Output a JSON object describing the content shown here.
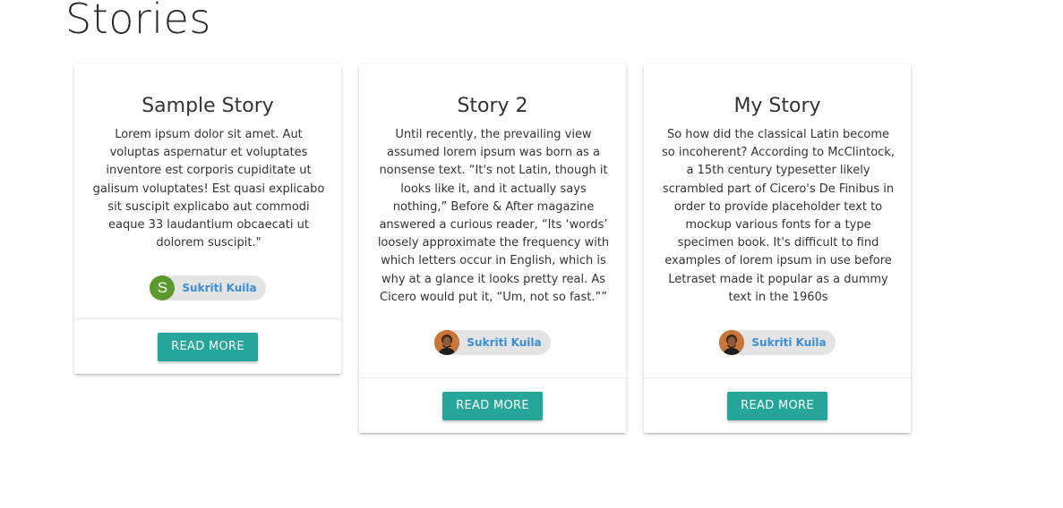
{
  "page": {
    "title": "Stories"
  },
  "colors": {
    "accent": "#26a69a",
    "author_link": "#3a8dd8",
    "avatar_initial_bg": "#5c9a2e",
    "chip_bg": "#e4e4e4"
  },
  "stories": [
    {
      "title": "Sample Story",
      "text": "Lorem ipsum dolor sit amet. Aut voluptas aspernatur et voluptates inventore est corporis cupiditate ut galisum voluptates! Est quasi explicabo sit suscipit explicabo aut commodi eaque 33 laudantium obcaecati ut dolorem suscipit.\"",
      "author": {
        "name": "Sukriti Kuila",
        "avatar_initial": "S",
        "avatar_icon": "letter-avatar"
      },
      "button_label": "READ MORE"
    },
    {
      "title": "Story 2",
      "text": "Until recently, the prevailing view assumed lorem ipsum was born as a nonsense text. “It's not Latin, though it looks like it, and it actually says nothing,” Before & After magazine answered a curious reader, “Its ‘words’ loosely approximate the frequency with which letters occur in English, which is why at a glance it looks pretty real. As Cicero would put it, “Um, not so fast.””",
      "author": {
        "name": "Sukriti Kuila",
        "avatar_icon": "user-photo-avatar"
      },
      "button_label": "READ MORE"
    },
    {
      "title": "My Story",
      "text": "So how did the classical Latin become so incoherent? According to McClintock, a 15th century typesetter likely scrambled part of Cicero's De Finibus in order to provide placeholder text to mockup various fonts for a type specimen book. It's difficult to find examples of lorem ipsum in use before Letraset made it popular as a dummy text in the 1960s",
      "author": {
        "name": "Sukriti Kuila",
        "avatar_icon": "user-photo-avatar"
      },
      "button_label": "READ MORE"
    }
  ]
}
